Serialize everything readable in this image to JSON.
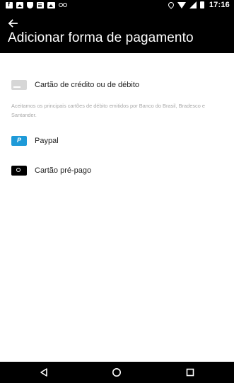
{
  "status_bar": {
    "time": "17:16",
    "icons": [
      "facebook-icon",
      "gallery-icon",
      "shield-icon",
      "document-icon",
      "photo-icon",
      "voicemail-icon",
      "location-icon",
      "wifi-icon",
      "signal-icon",
      "battery-icon"
    ]
  },
  "app_bar": {
    "back_icon": "arrow-left-icon",
    "title": "Adicionar forma de pagamento"
  },
  "payment_options": [
    {
      "label": "Cartão de crédito ou de débito",
      "icon": "credit-card-icon"
    },
    {
      "label": "Paypal",
      "icon": "paypal-icon"
    },
    {
      "label": "Cartão pré-pago",
      "icon": "prepaid-card-icon"
    }
  ],
  "note": "Aceitamos os principais cartões de débito emitidos por Banco do Brasil, Bradesco e Santander.",
  "nav_bar": {
    "back": "triangle-back-icon",
    "home": "circle-home-icon",
    "recents": "square-recents-icon"
  },
  "colors": {
    "bars": "#000000",
    "paypal_blue": "#1e9ad8",
    "card_grey": "#d6d6d6",
    "note_text": "#a8a8a8"
  }
}
